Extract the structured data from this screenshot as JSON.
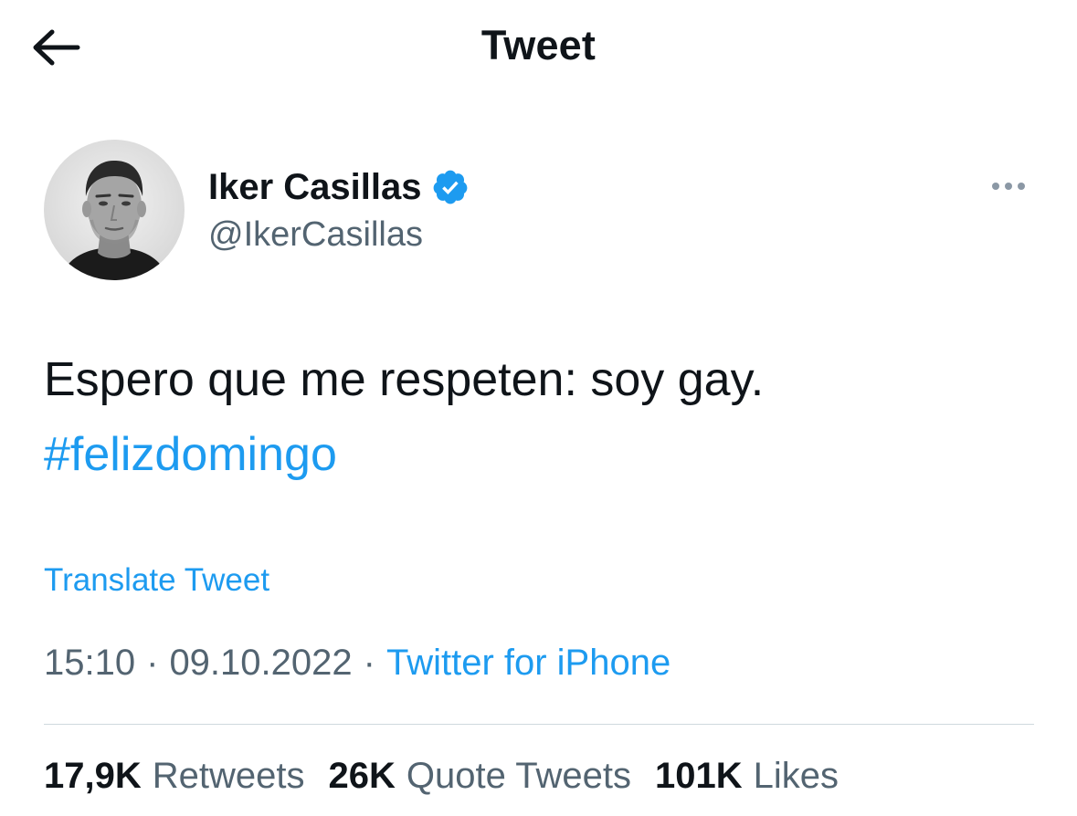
{
  "header": {
    "title": "Tweet",
    "back_icon": "arrow-left-icon"
  },
  "author": {
    "name": "Iker Casillas",
    "handle": "@IkerCasillas",
    "verified": true,
    "verified_color": "#1d9bf0"
  },
  "tweet": {
    "text": "Espero que me respeten: soy gay.",
    "hashtag": "#felizdomingo",
    "translate_label": "Translate Tweet",
    "time": "15:10",
    "date": "09.10.2022",
    "separator": "·",
    "source": "Twitter for iPhone"
  },
  "stats": [
    {
      "count": "17,9K",
      "label": "Retweets"
    },
    {
      "count": "26K",
      "label": "Quote Tweets"
    },
    {
      "count": "101K",
      "label": "Likes"
    }
  ],
  "colors": {
    "text": "#0f1419",
    "secondary": "#536471",
    "link": "#1d9bf0",
    "divider": "#cfd9de"
  }
}
